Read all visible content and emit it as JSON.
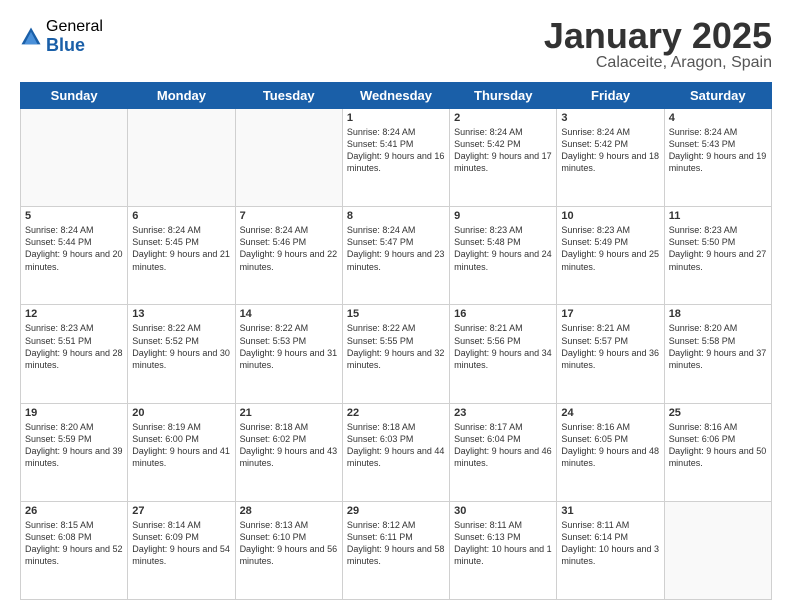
{
  "header": {
    "logo_general": "General",
    "logo_blue": "Blue",
    "title": "January 2025",
    "subtitle": "Calaceite, Aragon, Spain"
  },
  "days_of_week": [
    "Sunday",
    "Monday",
    "Tuesday",
    "Wednesday",
    "Thursday",
    "Friday",
    "Saturday"
  ],
  "weeks": [
    [
      {
        "day": "",
        "empty": true
      },
      {
        "day": "",
        "empty": true
      },
      {
        "day": "",
        "empty": true
      },
      {
        "day": "1",
        "sunrise": "8:24 AM",
        "sunset": "5:41 PM",
        "daylight": "9 hours and 16 minutes."
      },
      {
        "day": "2",
        "sunrise": "8:24 AM",
        "sunset": "5:42 PM",
        "daylight": "9 hours and 17 minutes."
      },
      {
        "day": "3",
        "sunrise": "8:24 AM",
        "sunset": "5:42 PM",
        "daylight": "9 hours and 18 minutes."
      },
      {
        "day": "4",
        "sunrise": "8:24 AM",
        "sunset": "5:43 PM",
        "daylight": "9 hours and 19 minutes."
      }
    ],
    [
      {
        "day": "5",
        "sunrise": "8:24 AM",
        "sunset": "5:44 PM",
        "daylight": "9 hours and 20 minutes."
      },
      {
        "day": "6",
        "sunrise": "8:24 AM",
        "sunset": "5:45 PM",
        "daylight": "9 hours and 21 minutes."
      },
      {
        "day": "7",
        "sunrise": "8:24 AM",
        "sunset": "5:46 PM",
        "daylight": "9 hours and 22 minutes."
      },
      {
        "day": "8",
        "sunrise": "8:24 AM",
        "sunset": "5:47 PM",
        "daylight": "9 hours and 23 minutes."
      },
      {
        "day": "9",
        "sunrise": "8:23 AM",
        "sunset": "5:48 PM",
        "daylight": "9 hours and 24 minutes."
      },
      {
        "day": "10",
        "sunrise": "8:23 AM",
        "sunset": "5:49 PM",
        "daylight": "9 hours and 25 minutes."
      },
      {
        "day": "11",
        "sunrise": "8:23 AM",
        "sunset": "5:50 PM",
        "daylight": "9 hours and 27 minutes."
      }
    ],
    [
      {
        "day": "12",
        "sunrise": "8:23 AM",
        "sunset": "5:51 PM",
        "daylight": "9 hours and 28 minutes."
      },
      {
        "day": "13",
        "sunrise": "8:22 AM",
        "sunset": "5:52 PM",
        "daylight": "9 hours and 30 minutes."
      },
      {
        "day": "14",
        "sunrise": "8:22 AM",
        "sunset": "5:53 PM",
        "daylight": "9 hours and 31 minutes."
      },
      {
        "day": "15",
        "sunrise": "8:22 AM",
        "sunset": "5:55 PM",
        "daylight": "9 hours and 32 minutes."
      },
      {
        "day": "16",
        "sunrise": "8:21 AM",
        "sunset": "5:56 PM",
        "daylight": "9 hours and 34 minutes."
      },
      {
        "day": "17",
        "sunrise": "8:21 AM",
        "sunset": "5:57 PM",
        "daylight": "9 hours and 36 minutes."
      },
      {
        "day": "18",
        "sunrise": "8:20 AM",
        "sunset": "5:58 PM",
        "daylight": "9 hours and 37 minutes."
      }
    ],
    [
      {
        "day": "19",
        "sunrise": "8:20 AM",
        "sunset": "5:59 PM",
        "daylight": "9 hours and 39 minutes."
      },
      {
        "day": "20",
        "sunrise": "8:19 AM",
        "sunset": "6:00 PM",
        "daylight": "9 hours and 41 minutes."
      },
      {
        "day": "21",
        "sunrise": "8:18 AM",
        "sunset": "6:02 PM",
        "daylight": "9 hours and 43 minutes."
      },
      {
        "day": "22",
        "sunrise": "8:18 AM",
        "sunset": "6:03 PM",
        "daylight": "9 hours and 44 minutes."
      },
      {
        "day": "23",
        "sunrise": "8:17 AM",
        "sunset": "6:04 PM",
        "daylight": "9 hours and 46 minutes."
      },
      {
        "day": "24",
        "sunrise": "8:16 AM",
        "sunset": "6:05 PM",
        "daylight": "9 hours and 48 minutes."
      },
      {
        "day": "25",
        "sunrise": "8:16 AM",
        "sunset": "6:06 PM",
        "daylight": "9 hours and 50 minutes."
      }
    ],
    [
      {
        "day": "26",
        "sunrise": "8:15 AM",
        "sunset": "6:08 PM",
        "daylight": "9 hours and 52 minutes."
      },
      {
        "day": "27",
        "sunrise": "8:14 AM",
        "sunset": "6:09 PM",
        "daylight": "9 hours and 54 minutes."
      },
      {
        "day": "28",
        "sunrise": "8:13 AM",
        "sunset": "6:10 PM",
        "daylight": "9 hours and 56 minutes."
      },
      {
        "day": "29",
        "sunrise": "8:12 AM",
        "sunset": "6:11 PM",
        "daylight": "9 hours and 58 minutes."
      },
      {
        "day": "30",
        "sunrise": "8:11 AM",
        "sunset": "6:13 PM",
        "daylight": "10 hours and 1 minute."
      },
      {
        "day": "31",
        "sunrise": "8:11 AM",
        "sunset": "6:14 PM",
        "daylight": "10 hours and 3 minutes."
      },
      {
        "day": "",
        "empty": true
      }
    ]
  ]
}
